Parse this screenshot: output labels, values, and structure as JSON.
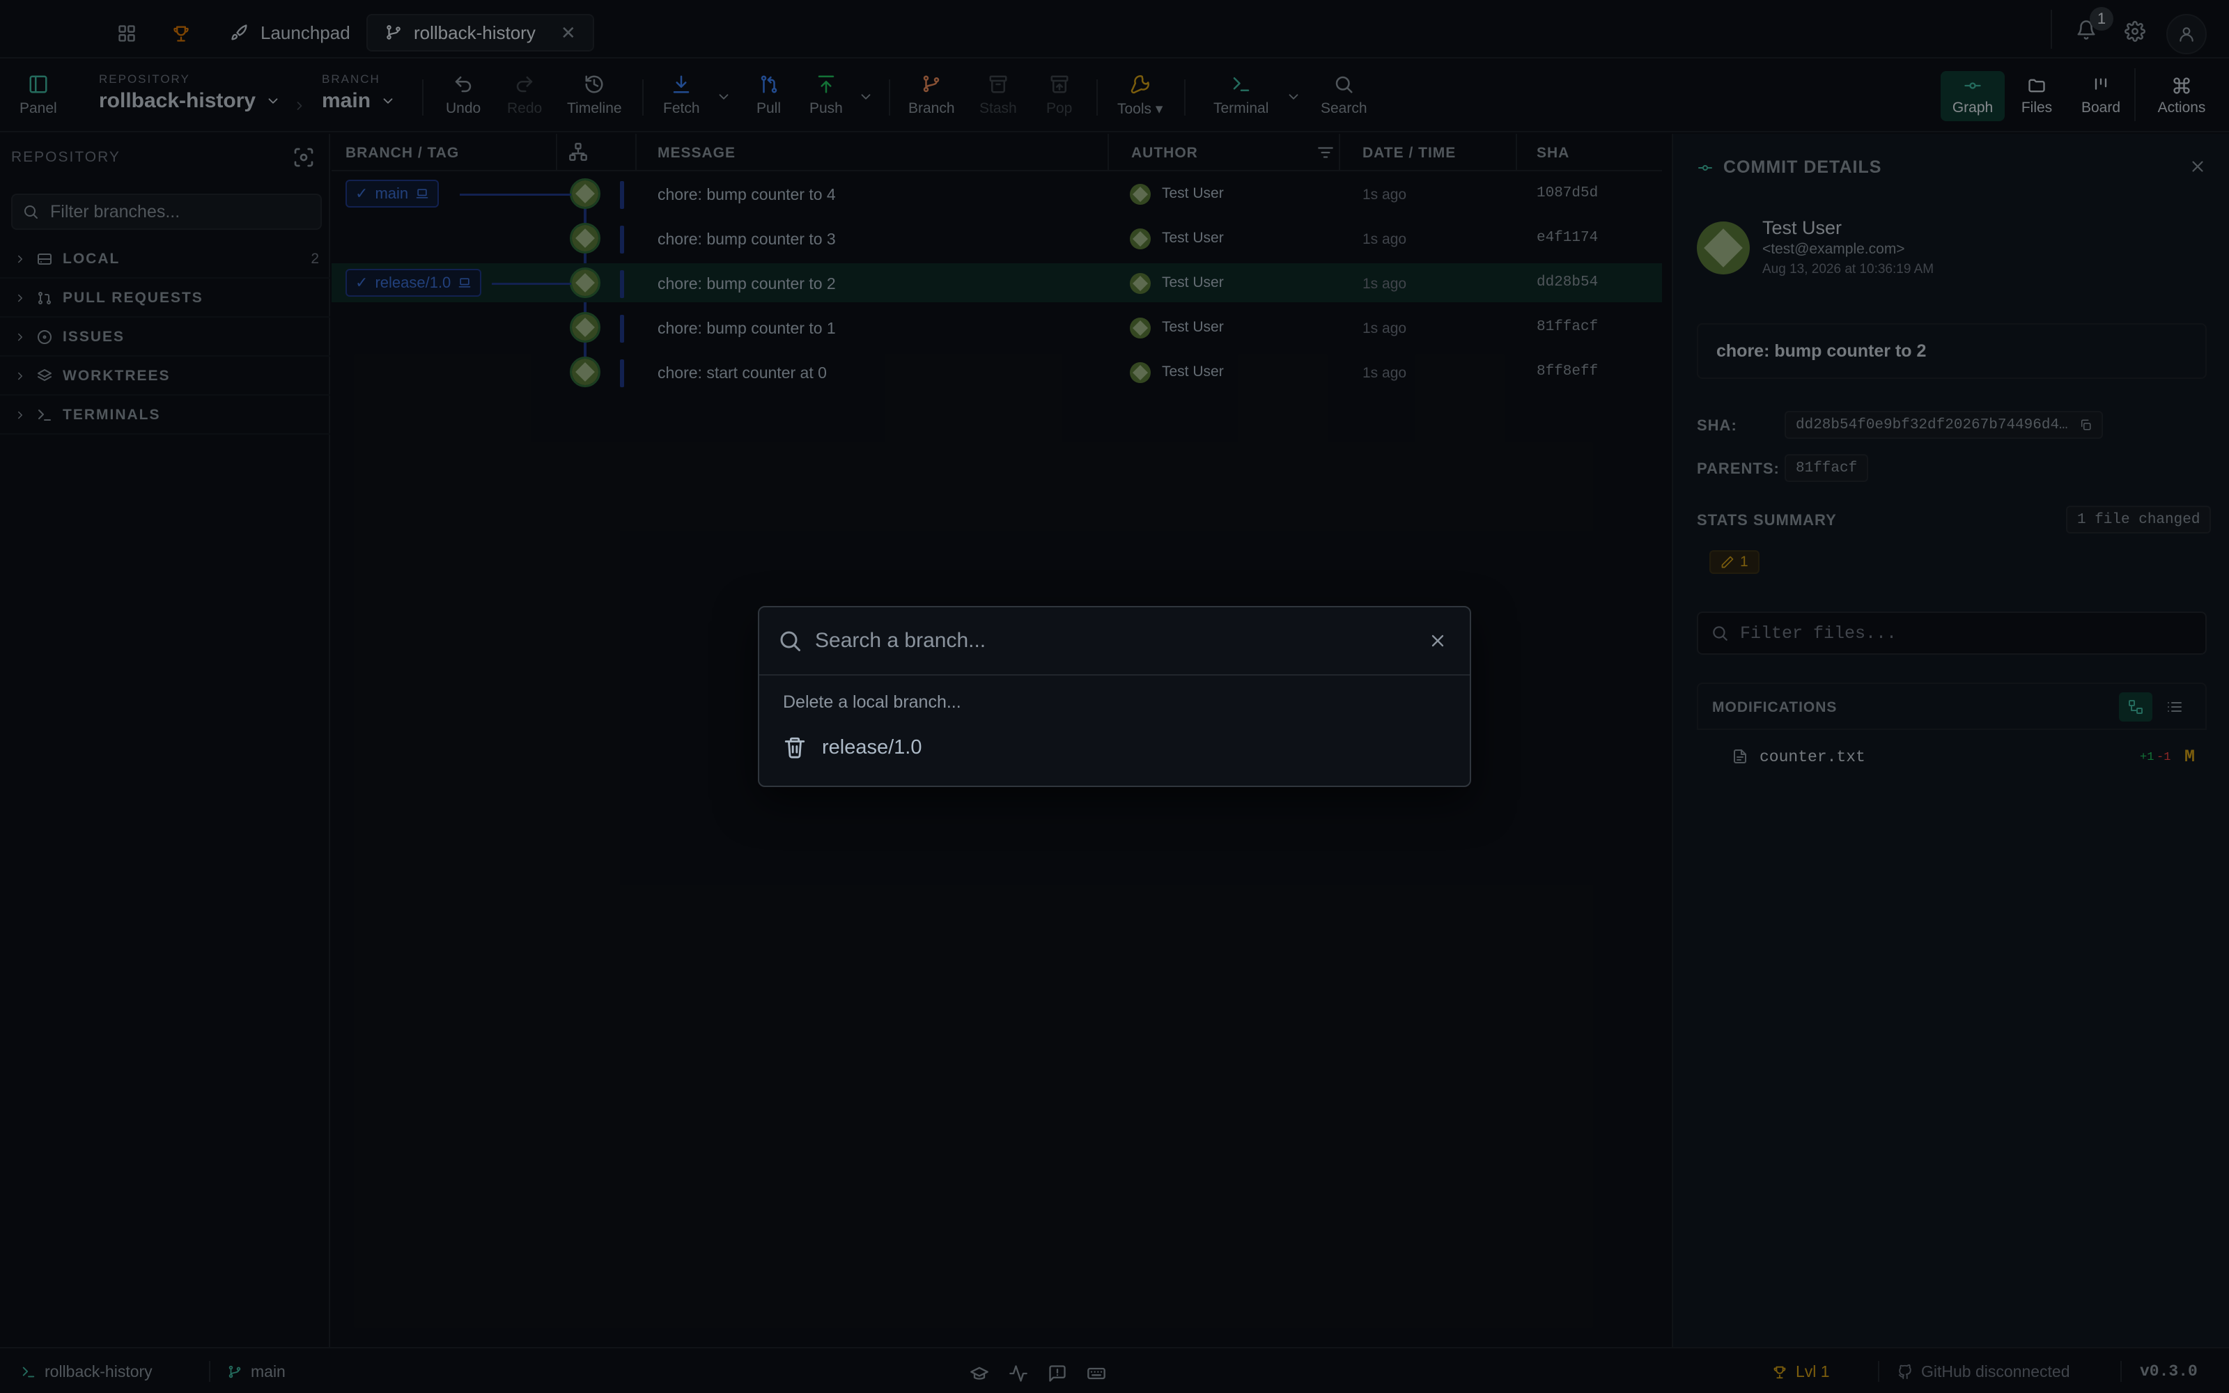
{
  "titlebar": {
    "tabs": [
      {
        "label": "Launchpad"
      },
      {
        "label": "rollback-history"
      }
    ],
    "notification_count": "1"
  },
  "toolbar": {
    "panel": "Panel",
    "repository_caption": "REPOSITORY",
    "repository": "rollback-history",
    "branch_caption": "BRANCH",
    "branch": "main",
    "undo": "Undo",
    "redo": "Redo",
    "timeline": "Timeline",
    "fetch": "Fetch",
    "pull": "Pull",
    "push": "Push",
    "branch_btn": "Branch",
    "stash": "Stash",
    "pop": "Pop",
    "tools": "Tools",
    "terminal": "Terminal",
    "search": "Search",
    "views": {
      "graph": "Graph",
      "files": "Files",
      "board": "Board",
      "actions": "Actions"
    }
  },
  "sidebar": {
    "heading": "REPOSITORY",
    "filter_placeholder": "Filter branches...",
    "sections": [
      {
        "label": "LOCAL",
        "count": "2"
      },
      {
        "label": "PULL REQUESTS"
      },
      {
        "label": "ISSUES"
      },
      {
        "label": "WORKTREES"
      },
      {
        "label": "TERMINALS"
      }
    ]
  },
  "graph": {
    "columns": {
      "branch": "BRANCH / TAG",
      "message": "MESSAGE",
      "author": "AUTHOR",
      "date": "DATE / TIME",
      "sha": "SHA"
    },
    "branch_labels": {
      "main": "main",
      "release": "release/1.0"
    },
    "commits": [
      {
        "message": "chore: bump counter to 4",
        "author": "Test User",
        "time": "1s ago",
        "sha": "1087d5d"
      },
      {
        "message": "chore: bump counter to 3",
        "author": "Test User",
        "time": "1s ago",
        "sha": "e4f1174"
      },
      {
        "message": "chore: bump counter to 2",
        "author": "Test User",
        "time": "1s ago",
        "sha": "dd28b54"
      },
      {
        "message": "chore: bump counter to 1",
        "author": "Test User",
        "time": "1s ago",
        "sha": "81ffacf"
      },
      {
        "message": "chore: start counter at 0",
        "author": "Test User",
        "time": "1s ago",
        "sha": "8ff8eff"
      }
    ]
  },
  "details": {
    "title": "COMMIT DETAILS",
    "author_name": "Test User",
    "author_email": "<test@example.com>",
    "date": "Aug 13, 2026 at 10:36:19 AM",
    "message": "chore: bump counter to 2",
    "sha_label": "SHA:",
    "sha": "dd28b54f0e9bf32df20267b74496d4…",
    "parents_label": "PARENTS:",
    "parent": "81ffacf",
    "stats_label": "STATS SUMMARY",
    "files_changed": "1 file changed",
    "modified_count": "1",
    "filter_placeholder": "Filter files...",
    "modifications_label": "MODIFICATIONS",
    "file": {
      "name": "counter.txt",
      "added": "+1",
      "removed": "-1",
      "status": "M"
    }
  },
  "dialog": {
    "search_placeholder": "Search a branch...",
    "hint": "Delete a local branch...",
    "item": "release/1.0"
  },
  "statusbar": {
    "repo": "rollback-history",
    "branch": "main",
    "level": "Lvl 1",
    "github": "GitHub disconnected",
    "version": "v0.3.0"
  },
  "colors": {
    "accent": "#3fb9a0",
    "lane": "#1f3a8a",
    "fetch": "#3b82f6",
    "push": "#22c55e",
    "warning": "#d4a017"
  }
}
